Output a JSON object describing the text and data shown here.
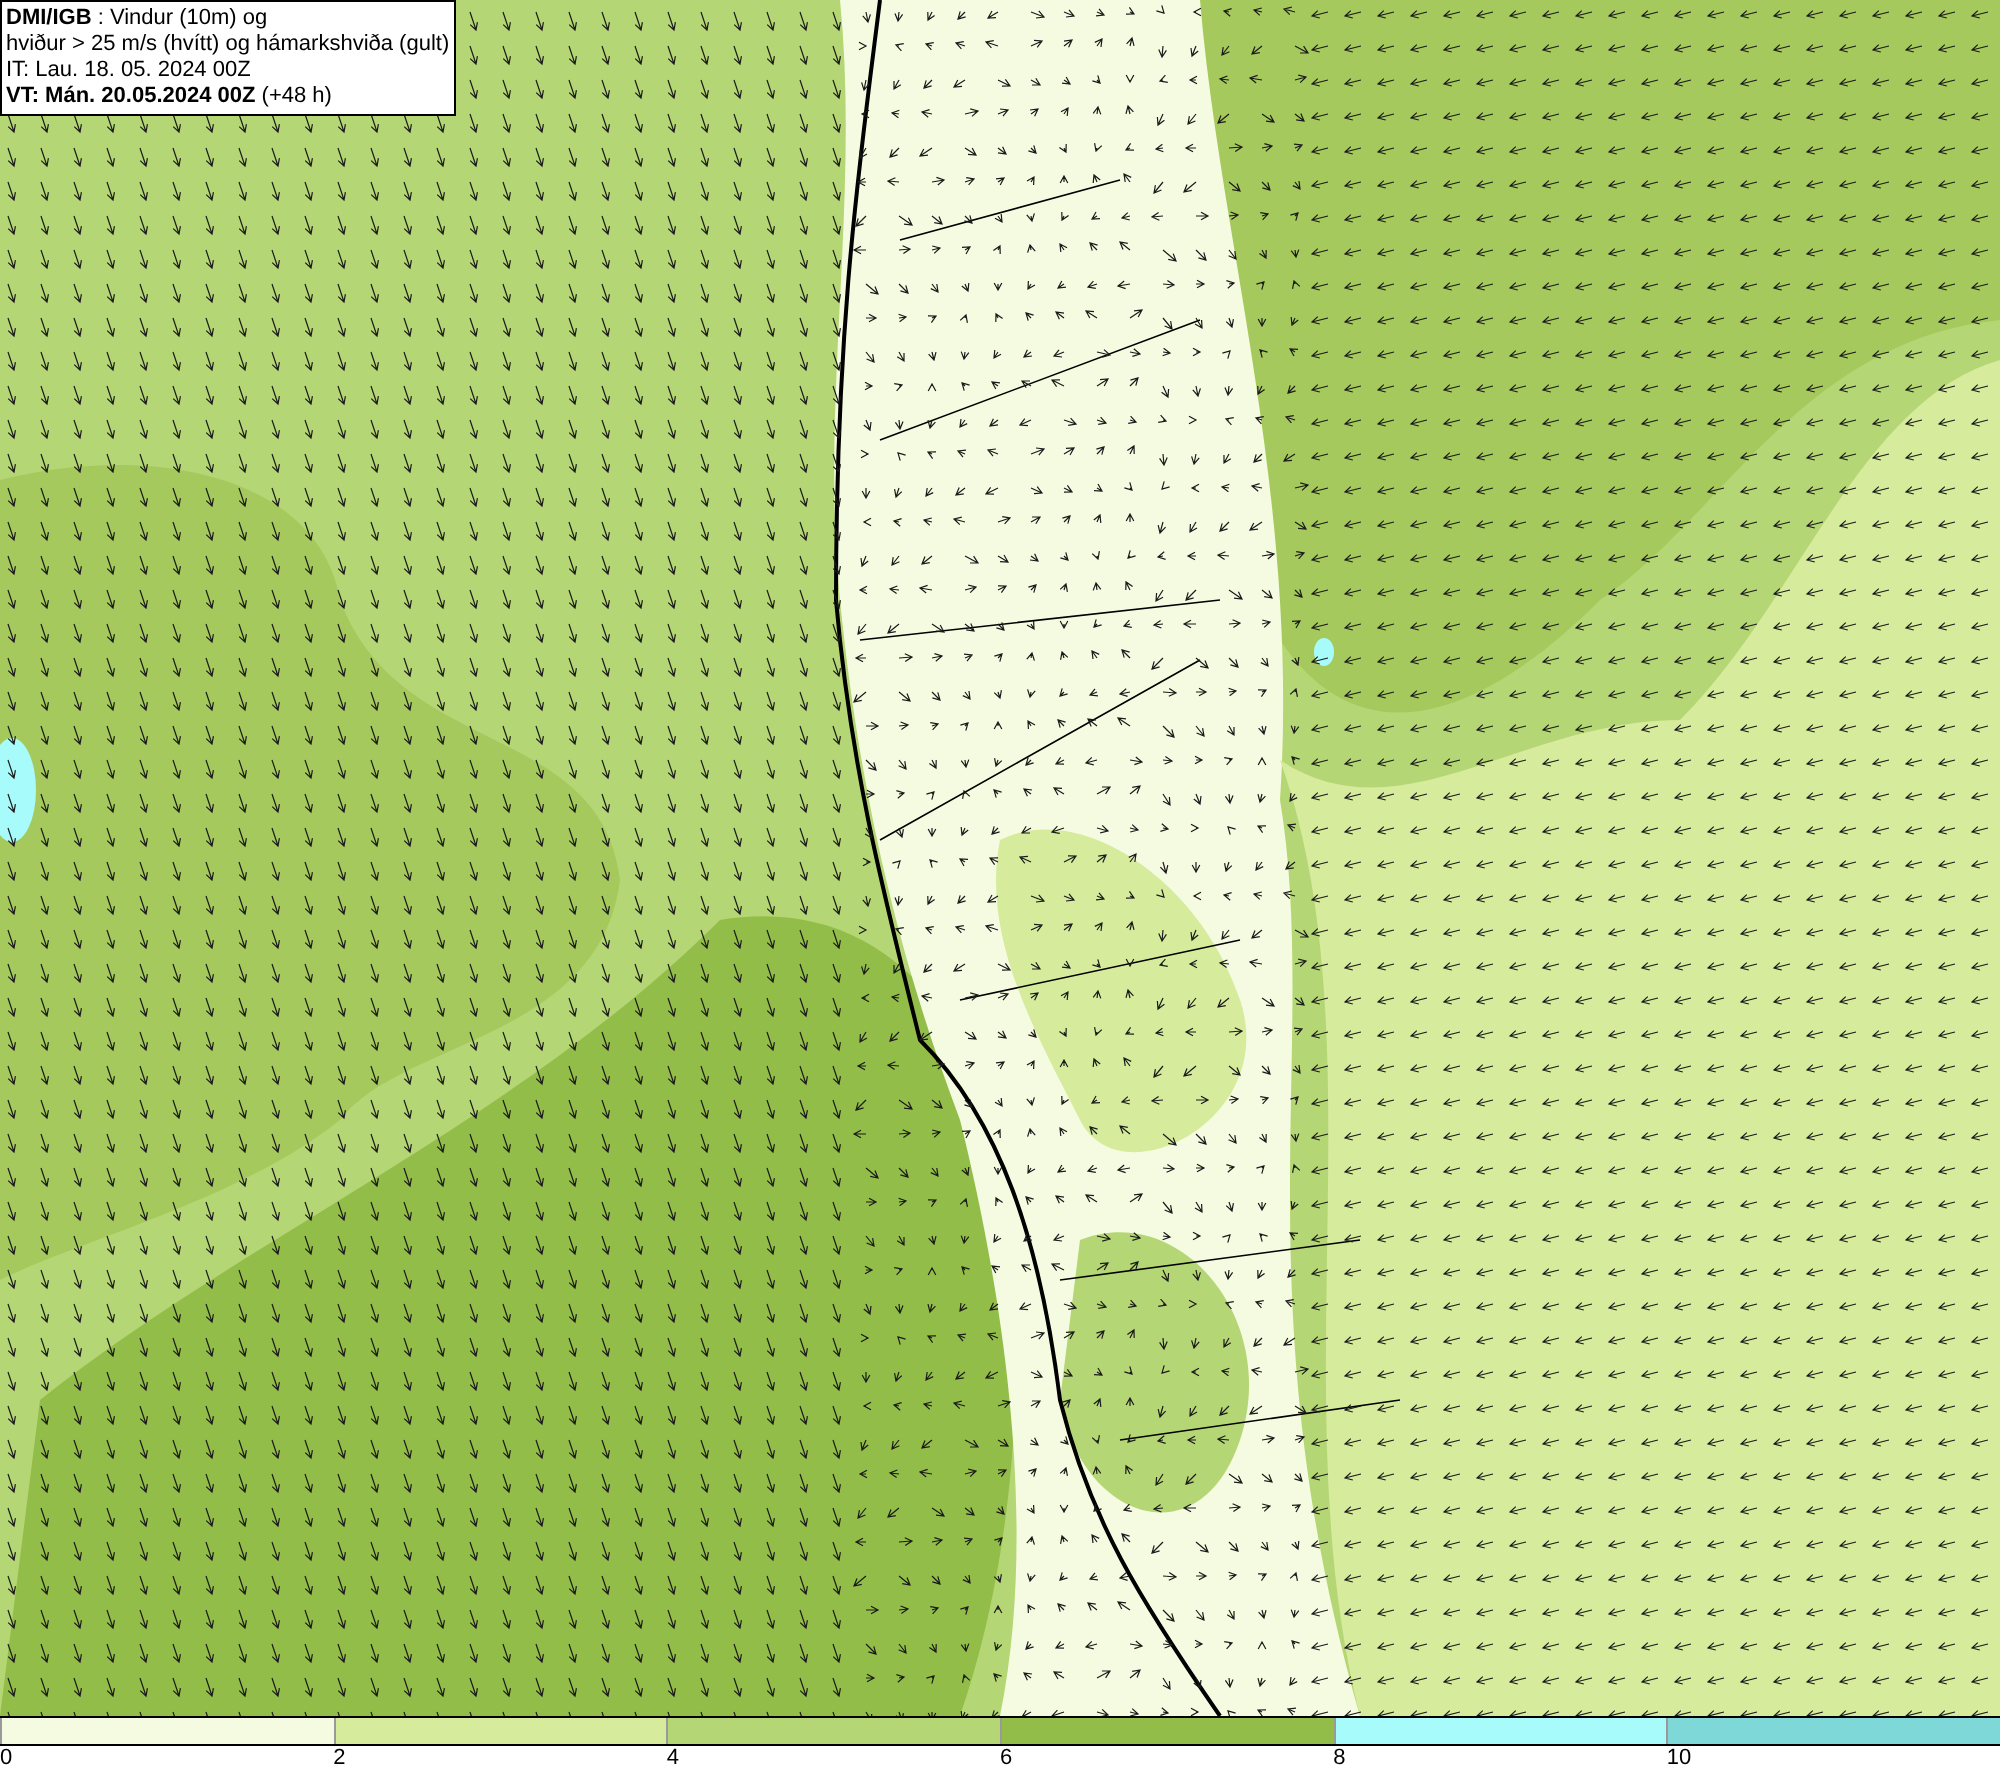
{
  "info_box": {
    "lines": [
      "**DMI/IGB** : Vindur (10m) og",
      "hviður > 25 m/s (hvítt) og hámarkshviða (gult)",
      "IT: Lau. 18. 05. 2024 00Z",
      "**VT: Mán. 20.05.2024 00Z** (+48 h)"
    ]
  },
  "legend": {
    "segments": [
      {
        "color": "#f5fbe0",
        "label": "0"
      },
      {
        "color": "#d6eb9c",
        "label": "2"
      },
      {
        "color": "#b5d674",
        "label": "4"
      },
      {
        "color": "#93bd49",
        "label": "6"
      },
      {
        "color": "#a8fbfb",
        "label": "8"
      },
      {
        "color": "#7fd8d8",
        "label": "10"
      }
    ]
  }
}
